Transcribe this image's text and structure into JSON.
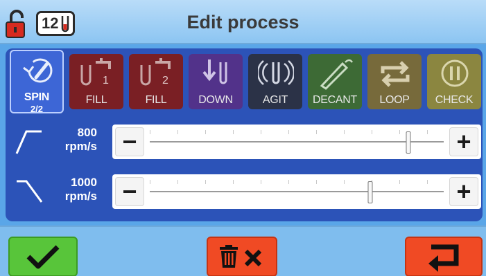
{
  "header": {
    "title": "Edit process",
    "counter": "12"
  },
  "steps": [
    {
      "label": "SPIN",
      "sub": "2/2",
      "icon": "spin-icon",
      "color": "#3d66d6",
      "active": true
    },
    {
      "label": "FILL",
      "badge": "1",
      "icon": "fill-tap-icon",
      "color": "#7a1f24"
    },
    {
      "label": "FILL",
      "badge": "2",
      "icon": "fill-tap-icon",
      "color": "#7a1f24"
    },
    {
      "label": "DOWN",
      "icon": "down-arrow-icon",
      "color": "#52328a"
    },
    {
      "label": "AGIT",
      "icon": "agitate-icon",
      "color": "#2b3247"
    },
    {
      "label": "DECANT",
      "icon": "decant-icon",
      "color": "#3d6a35"
    },
    {
      "label": "LOOP",
      "icon": "loop-icon",
      "color": "#776a3b"
    },
    {
      "label": "CHECK",
      "icon": "pause-icon",
      "color": "#8b8640"
    }
  ],
  "sliders": [
    {
      "value": "800",
      "unit": "rpm/s",
      "icon": "ramp-up-icon",
      "level": 0.88
    },
    {
      "value": "1000",
      "unit": "rpm/s",
      "icon": "ramp-down-icon",
      "level": 0.75
    }
  ],
  "footer": {
    "confirm_icon": "checkmark-icon",
    "delete_icon": "trash-x-icon",
    "back_icon": "return-arrow-icon"
  },
  "colors": {
    "background": "#5aa6e8",
    "panel": "#2c53b8",
    "confirm": "#58c53a",
    "danger": "#f04a24"
  }
}
